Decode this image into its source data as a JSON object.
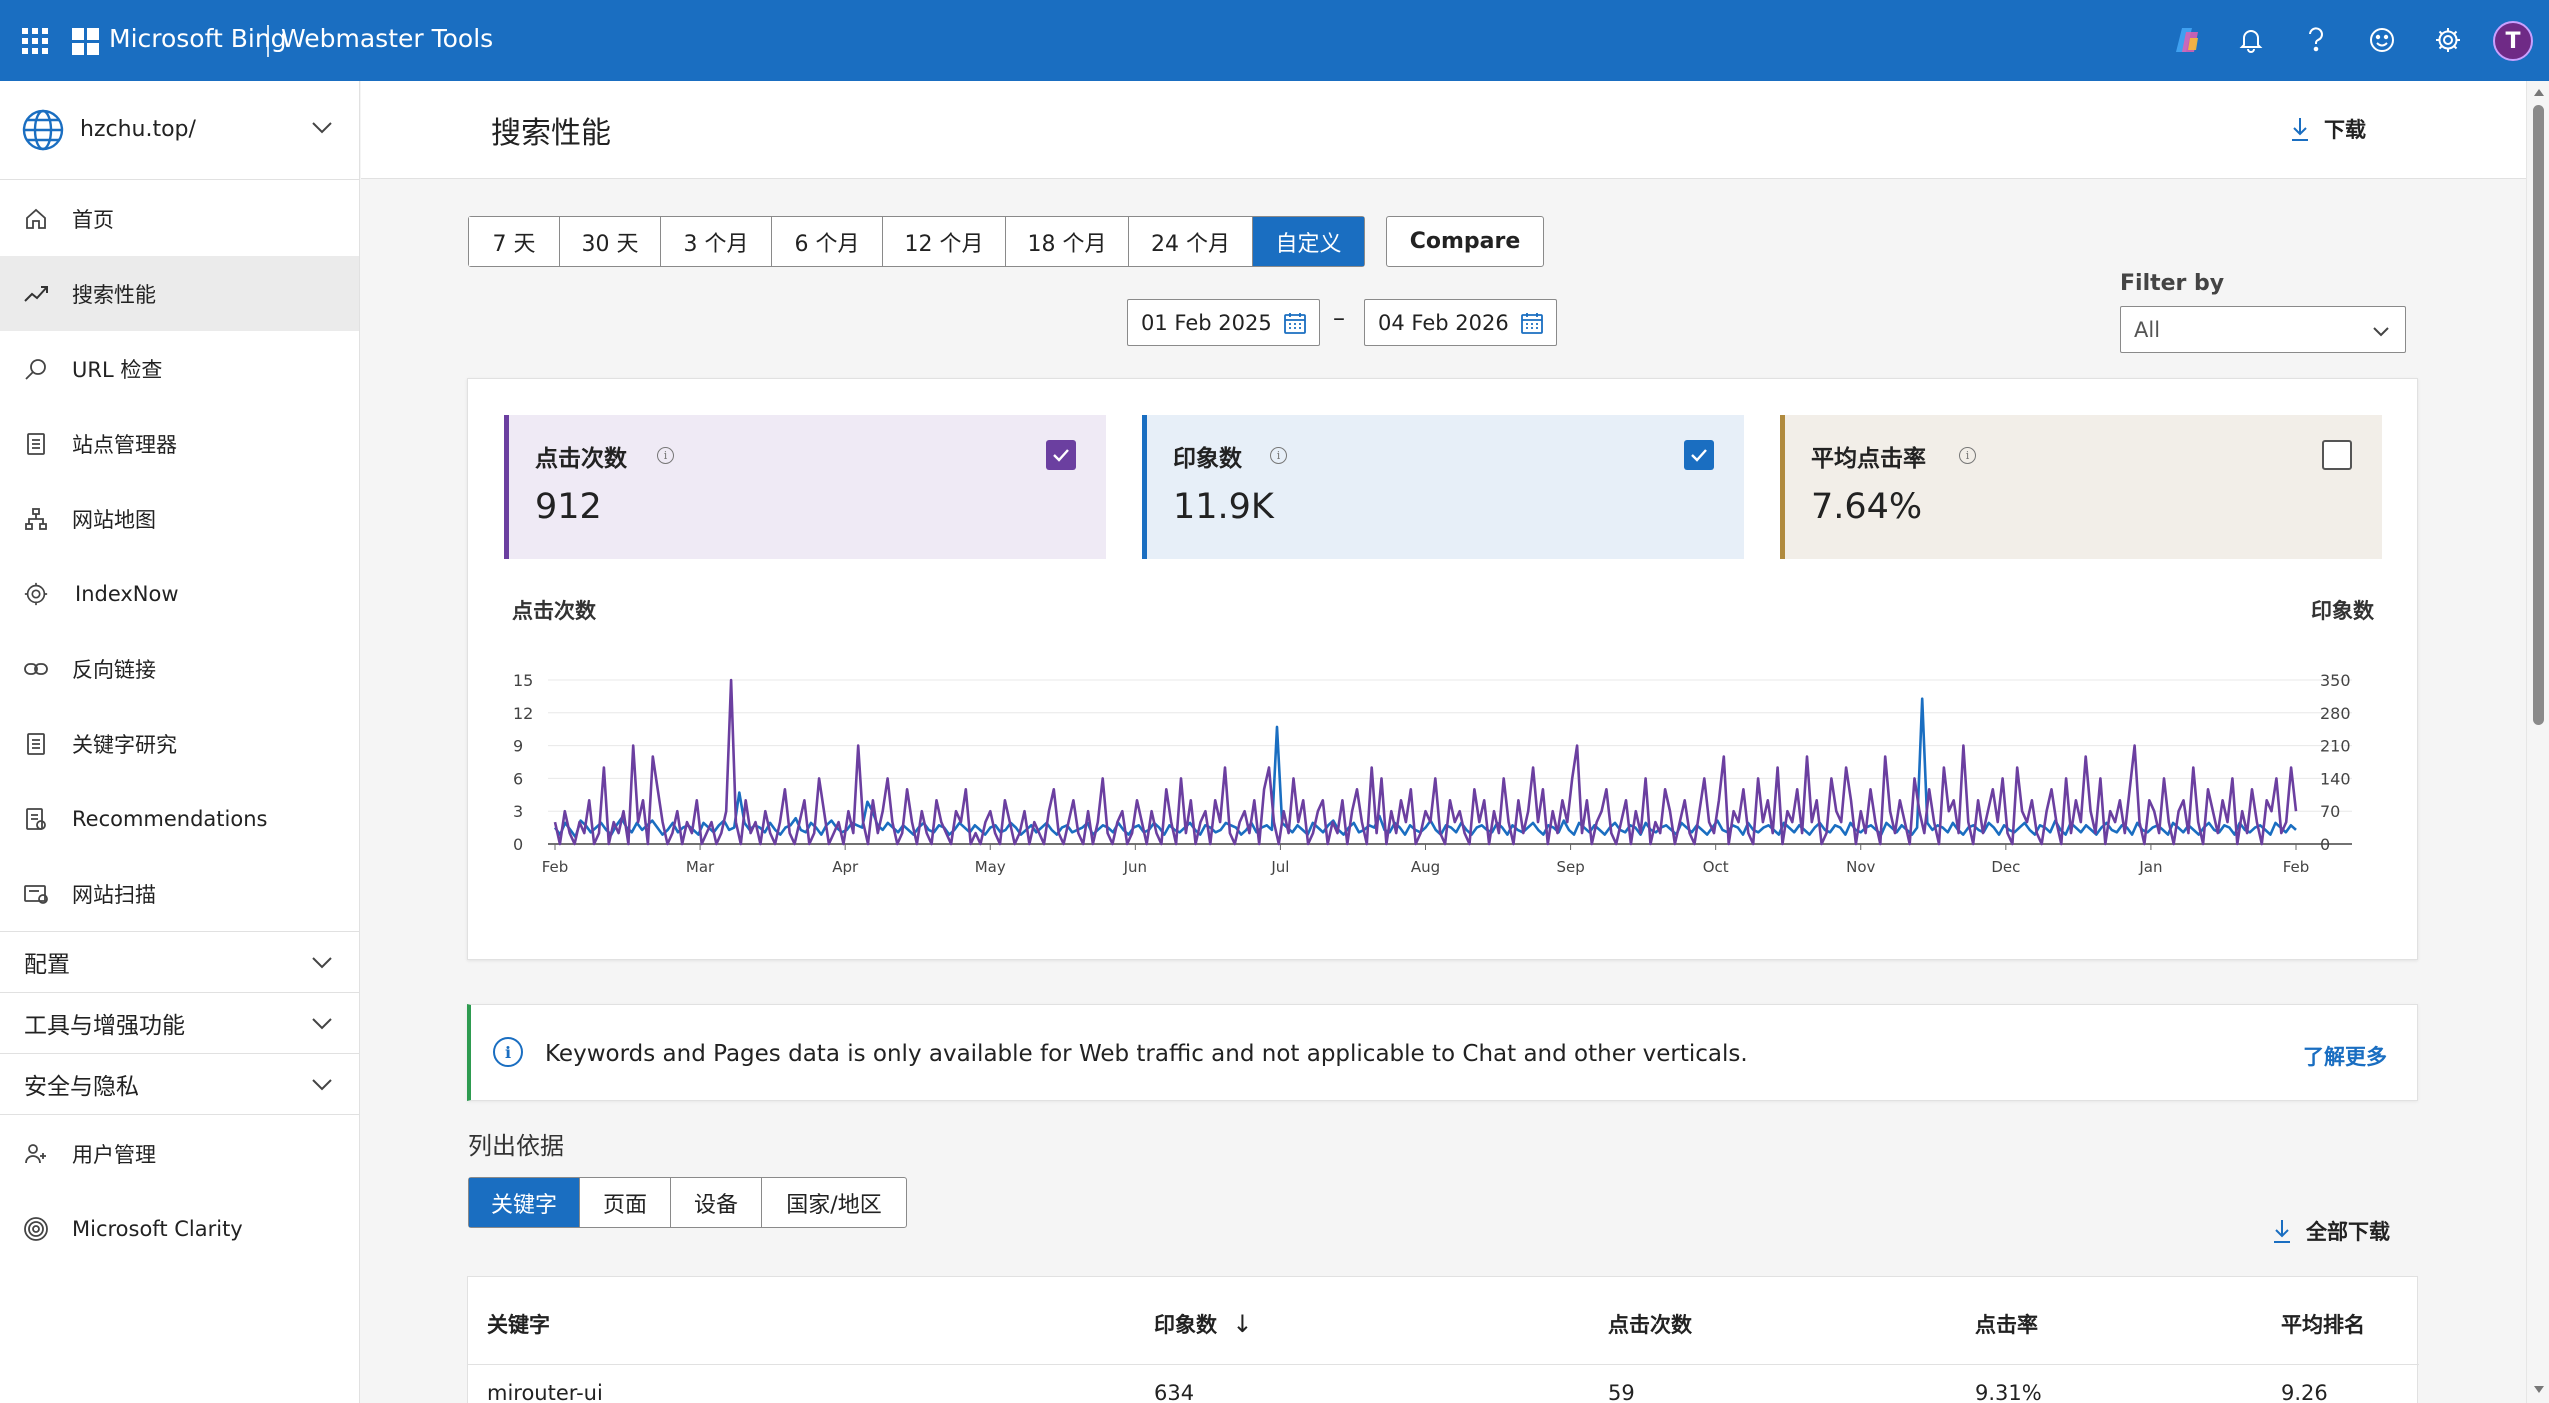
{
  "topbar": {
    "brand": "Microsoft Bing",
    "product": "Webmaster Tools",
    "icons": [
      "copilot-icon",
      "bell-icon",
      "help-icon",
      "feedback-icon",
      "gear-icon"
    ],
    "avatar_initial": "T"
  },
  "sidebar": {
    "site": "hzchu.top/",
    "items": [
      {
        "label": "首页",
        "icon": "home-icon"
      },
      {
        "label": "搜索性能",
        "icon": "trend-icon",
        "active": true
      },
      {
        "label": "URL 检查",
        "icon": "search-icon"
      },
      {
        "label": "站点管理器",
        "icon": "document-icon"
      },
      {
        "label": "网站地图",
        "icon": "sitemap-icon"
      },
      {
        "label": "IndexNow",
        "icon": "gear-icon"
      },
      {
        "label": "反向链接",
        "icon": "link-icon"
      },
      {
        "label": "关键字研究",
        "icon": "document-icon"
      },
      {
        "label": "Recommendations",
        "icon": "recommendations-icon"
      },
      {
        "label": "网站扫描",
        "icon": "scan-icon"
      }
    ],
    "groups": [
      {
        "label": "配置"
      },
      {
        "label": "工具与增强功能"
      },
      {
        "label": "安全与隐私"
      }
    ],
    "bottom_items": [
      {
        "label": "用户管理",
        "icon": "users-icon"
      },
      {
        "label": "Microsoft Clarity",
        "icon": "clarity-icon"
      }
    ]
  },
  "main": {
    "title": "搜索性能",
    "download_label": "下载",
    "ranges": [
      "7 天",
      "30 天",
      "3 个月",
      "6 个月",
      "12 个月",
      "18 个月",
      "24 个月",
      "自定义"
    ],
    "active_range": "自定义",
    "compare_label": "Compare",
    "date_from": "01 Feb 2025",
    "date_sep": "–",
    "date_to": "04 Feb 2026",
    "filter_label": "Filter by",
    "filter_value": "All"
  },
  "metrics": [
    {
      "title": "点击次数",
      "value": "912",
      "checked": true,
      "color": "#6b3fa0",
      "bg": "#efeaf5"
    },
    {
      "title": "印象数",
      "value": "11.9K",
      "checked": true,
      "color": "#1a6ec1",
      "bg": "#e7eff8"
    },
    {
      "title": "平均点击率",
      "value": "7.64%",
      "checked": false,
      "color": "#b08a3e",
      "bg": "#f2eee8"
    }
  ],
  "chart_data": {
    "type": "line",
    "left_axis_label": "点击次数",
    "right_axis_label": "印象数",
    "left_ticks": [
      0,
      3,
      6,
      9,
      12,
      15
    ],
    "right_ticks": [
      0,
      70,
      140,
      210,
      280,
      350
    ],
    "ylim_left": [
      0,
      15
    ],
    "ylim_right": [
      0,
      350
    ],
    "x_ticks": [
      "Feb",
      "Mar",
      "Apr",
      "May",
      "Jun",
      "Jul",
      "Aug",
      "Sep",
      "Oct",
      "Nov",
      "Dec",
      "Jan",
      "Feb"
    ],
    "grid": true,
    "series": [
      {
        "name": "点击次数",
        "axis": "left",
        "color": "#6b3fa0",
        "values": [
          2,
          0,
          3,
          1,
          0,
          2,
          1,
          4,
          0,
          1,
          7,
          0,
          2,
          1,
          3,
          0,
          9,
          2,
          4,
          0,
          8,
          5,
          2,
          0,
          1,
          3,
          0,
          2,
          1,
          4,
          0,
          1,
          2,
          0,
          1,
          3,
          15,
          2,
          0,
          4,
          1,
          2,
          0,
          3,
          1,
          0,
          2,
          5,
          1,
          0,
          2,
          4,
          0,
          1,
          6,
          3,
          0,
          1,
          2,
          0,
          3,
          1,
          9,
          2,
          0,
          4,
          1,
          3,
          6,
          2,
          0,
          1,
          5,
          2,
          0,
          3,
          1,
          0,
          4,
          2,
          1,
          0,
          3,
          2,
          5,
          0,
          1,
          0,
          2,
          3,
          1,
          0,
          4,
          2,
          0,
          1,
          3,
          0,
          2,
          1,
          0,
          3,
          5,
          1,
          0,
          2,
          4,
          1,
          0,
          3,
          0,
          2,
          6,
          1,
          0,
          2,
          3,
          0,
          1,
          4,
          2,
          0,
          3,
          1,
          0,
          5,
          2,
          0,
          6,
          1,
          4,
          0,
          2,
          3,
          0,
          4,
          2,
          7,
          1,
          0,
          2,
          3,
          1,
          4,
          0,
          5,
          7,
          2,
          0,
          3,
          1,
          6,
          2,
          4,
          0,
          1,
          3,
          4,
          0,
          2,
          1,
          4,
          0,
          3,
          5,
          2,
          0,
          7,
          1,
          6,
          0,
          3,
          1,
          4,
          2,
          5,
          0,
          1,
          3,
          2,
          6,
          1,
          0,
          4,
          2,
          3,
          1,
          0,
          5,
          2,
          4,
          0,
          3,
          1,
          6,
          2,
          0,
          4,
          1,
          3,
          7,
          2,
          5,
          0,
          3,
          1,
          4,
          2,
          6,
          9,
          1,
          4,
          0,
          2,
          3,
          5,
          1,
          0,
          2,
          4,
          0,
          3,
          1,
          6,
          0,
          2,
          1,
          5,
          3,
          0,
          2,
          4,
          1,
          0,
          3,
          6,
          2,
          1,
          4,
          8,
          0,
          3,
          2,
          5,
          1,
          0,
          6,
          2,
          4,
          1,
          7,
          0,
          3,
          2,
          5,
          1,
          8,
          2,
          4,
          0,
          1,
          6,
          3,
          2,
          7,
          4,
          0,
          3,
          1,
          5,
          2,
          0,
          8,
          3,
          1,
          4,
          2,
          0,
          6,
          3,
          1,
          5,
          2,
          0,
          7,
          3,
          4,
          1,
          9,
          2,
          0,
          4,
          1,
          3,
          5,
          2,
          6,
          1,
          0,
          7,
          3,
          2,
          4,
          1,
          0,
          3,
          5,
          2,
          0,
          6,
          1,
          4,
          2,
          8,
          3,
          1,
          6,
          0,
          3,
          2,
          4,
          1,
          5,
          9,
          2,
          0,
          4,
          3,
          1,
          6,
          2,
          0,
          3,
          4,
          1,
          7,
          2,
          0,
          5,
          3,
          1,
          4,
          2,
          6,
          0,
          3,
          1,
          5,
          2,
          0,
          4,
          3,
          6,
          1,
          2,
          7,
          3
        ]
      },
      {
        "name": "印象数",
        "axis": "left_scaled",
        "color": "#1a6ec1",
        "values": [
          35,
          20,
          45,
          30,
          15,
          50,
          40,
          25,
          35,
          45,
          30,
          20,
          40,
          55,
          35,
          25,
          45,
          30,
          40,
          50,
          35,
          20,
          30,
          45,
          25,
          35,
          40,
          30,
          20,
          45,
          35,
          25,
          40,
          50,
          30,
          35,
          110,
          45,
          30,
          40,
          35,
          25,
          45,
          30,
          20,
          35,
          40,
          55,
          30,
          25,
          45,
          35,
          20,
          40,
          50,
          35,
          25,
          30,
          45,
          40,
          35,
          90,
          70,
          40,
          30,
          45,
          35,
          25,
          40,
          30,
          20,
          35,
          45,
          30,
          25,
          40,
          35,
          20,
          30,
          45,
          35,
          25,
          40,
          30,
          20,
          35,
          40,
          25,
          30,
          45,
          35,
          20,
          30,
          40,
          25,
          35,
          45,
          30,
          20,
          35,
          40,
          25,
          30,
          35,
          45,
          20,
          30,
          40,
          35,
          25,
          45,
          30,
          20,
          35,
          40,
          25,
          30,
          45,
          35,
          20,
          40,
          30,
          25,
          35,
          45,
          30,
          20,
          40,
          35,
          25,
          30,
          45,
          40,
          35,
          20,
          30,
          45,
          25,
          35,
          40,
          30,
          250,
          45,
          35,
          25,
          40,
          30,
          20,
          45,
          35,
          25,
          40,
          50,
          30,
          20,
          35,
          45,
          25,
          30,
          40,
          35,
          60,
          30,
          25,
          45,
          35,
          20,
          40,
          30,
          25,
          35,
          50,
          30,
          20,
          40,
          35,
          25,
          45,
          30,
          20,
          35,
          40,
          30,
          25,
          45,
          35,
          20,
          40,
          30,
          25,
          35,
          45,
          30,
          20,
          40,
          35,
          25,
          50,
          30,
          20,
          45,
          35,
          25,
          40,
          30,
          20,
          35,
          45,
          30,
          25,
          40,
          35,
          20,
          45,
          30,
          25,
          35,
          40,
          30,
          20,
          45,
          35,
          25,
          40,
          30,
          20,
          35,
          50,
          30,
          25,
          40,
          35,
          20,
          45,
          30,
          25,
          35,
          40,
          30,
          20,
          45,
          35,
          25,
          40,
          30,
          20,
          35,
          45,
          30,
          25,
          40,
          35,
          20,
          45,
          30,
          25,
          35,
          40,
          30,
          20,
          45,
          35,
          25,
          40,
          30,
          20,
          35,
          310,
          45,
          30,
          40,
          35,
          25,
          45,
          30,
          20,
          35,
          40,
          30,
          25,
          45,
          35,
          20,
          40,
          30,
          25,
          35,
          45,
          30,
          20,
          40,
          35,
          25,
          50,
          30,
          20,
          45,
          35,
          25,
          40,
          30,
          20,
          35,
          45,
          30,
          25,
          40,
          35,
          20,
          45,
          30,
          25,
          35,
          40,
          30,
          20,
          45,
          35,
          25,
          40,
          30,
          20,
          35,
          45,
          30,
          25,
          40,
          35,
          20,
          45,
          30,
          25,
          35,
          40,
          30,
          20,
          45,
          35,
          25,
          40,
          30
        ]
      }
    ]
  },
  "banner": {
    "text_parts": [
      "Keywords",
      " and ",
      "Pages",
      " data is only available for ",
      "Web",
      " traffic and not applicable to Chat and other verticals."
    ],
    "link": "了解更多"
  },
  "list": {
    "label": "列出依据",
    "tabs": [
      "关键字",
      "页面",
      "设备",
      "国家/地区"
    ],
    "active_tab": "关键字",
    "download_all": "全部下载"
  },
  "table": {
    "columns": [
      "关键字",
      "印象数",
      "点击次数",
      "点击率",
      "平均排名"
    ],
    "sort_indicator": "↓",
    "rows": [
      [
        "mirouter-ui",
        "634",
        "59",
        "9.31%",
        "9.26"
      ]
    ]
  }
}
